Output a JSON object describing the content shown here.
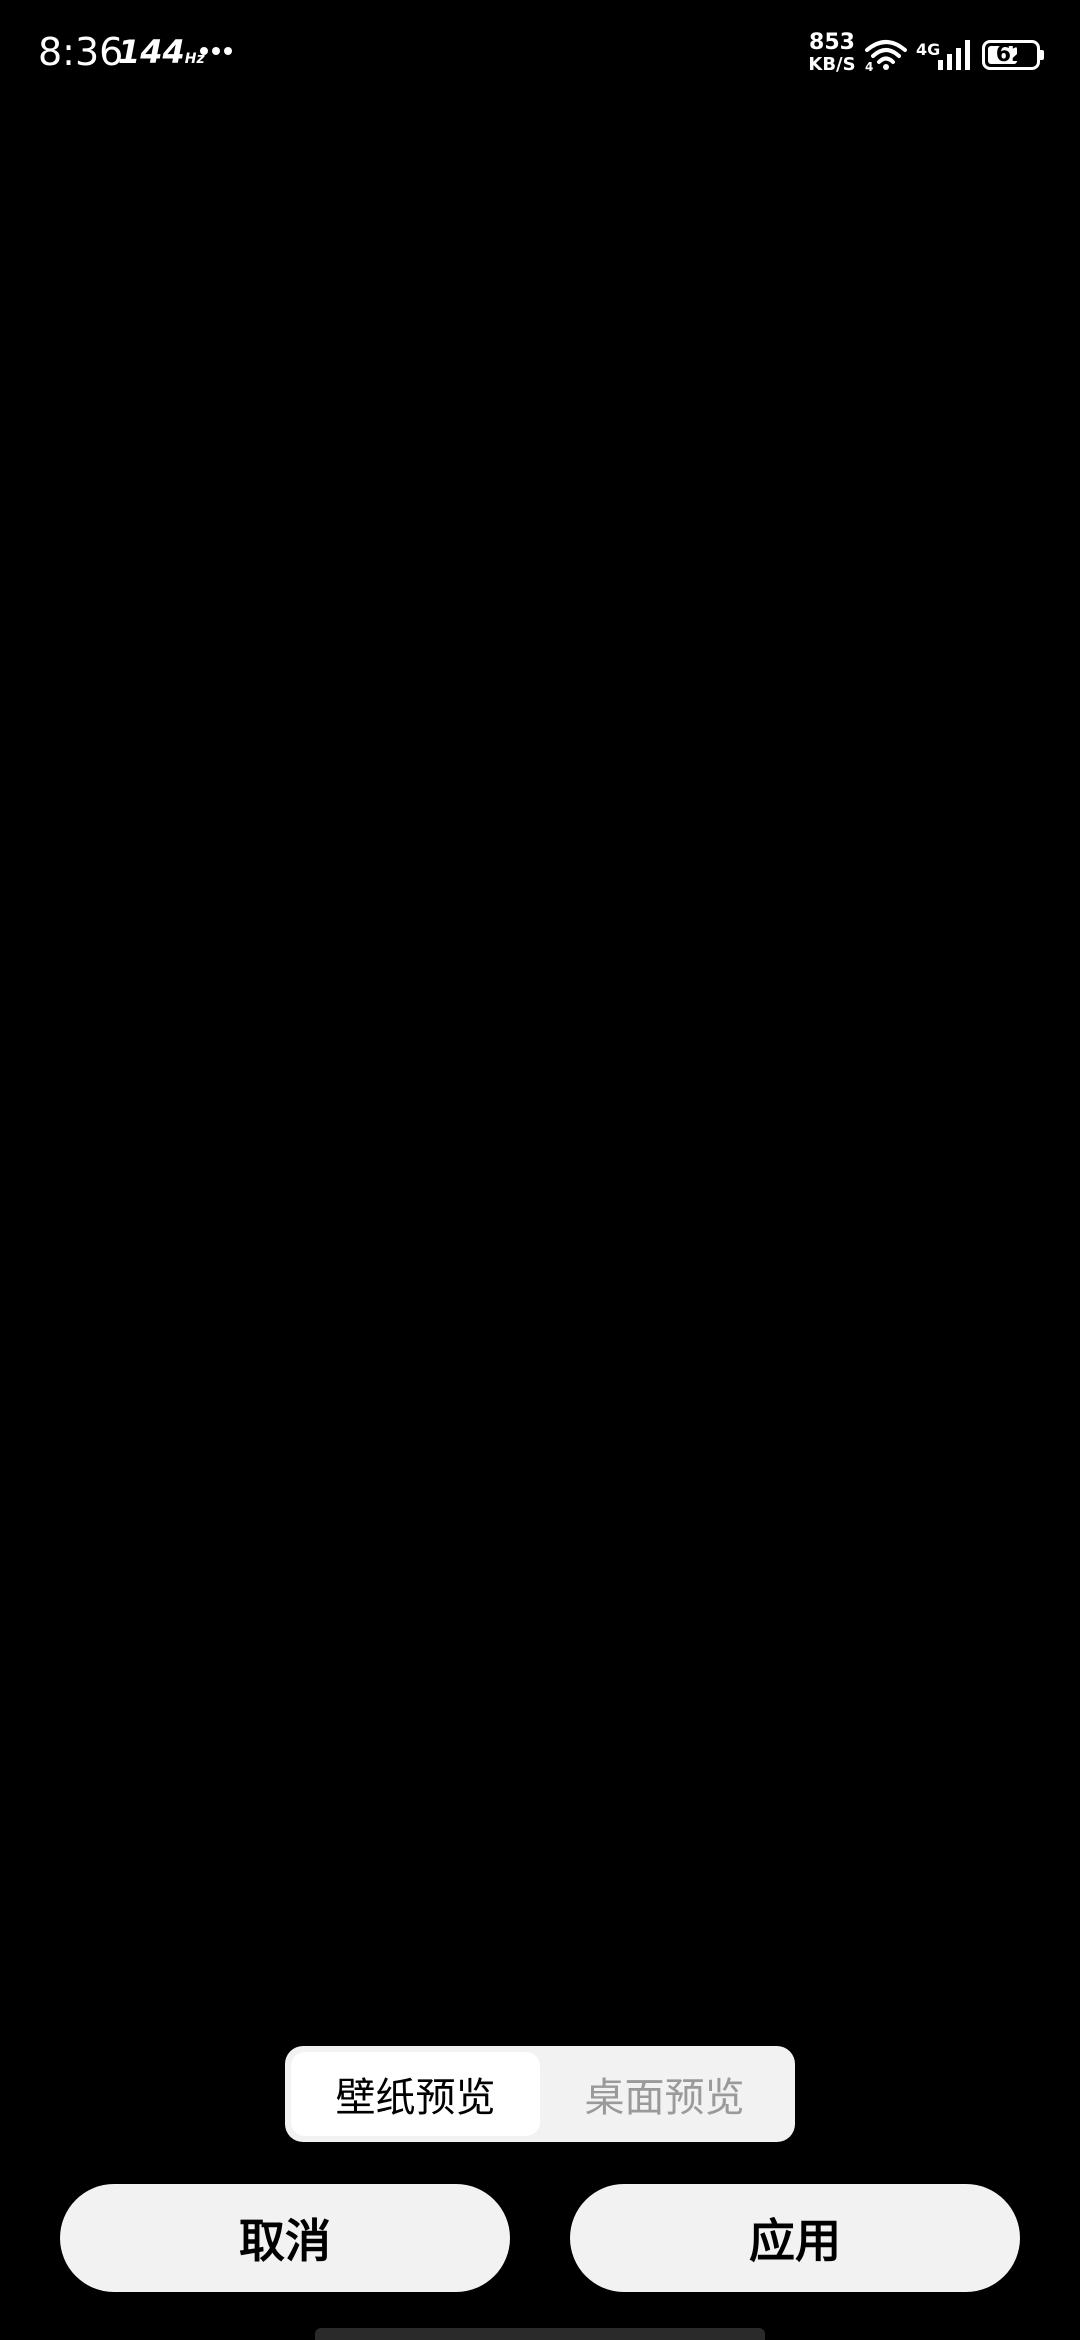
{
  "status_bar": {
    "time": "8:36",
    "refresh_rate": "144",
    "refresh_unit": "Hz",
    "net_speed_value": "853",
    "net_speed_unit": "KB/S",
    "wifi_sub": "4",
    "network_type": "4G",
    "battery_level": "62",
    "battery_fraction": 0.62
  },
  "segmented": {
    "active_label": "壁纸预览",
    "inactive_label": "桌面预览"
  },
  "actions": {
    "cancel_label": "取消",
    "apply_label": "应用"
  },
  "colors": {
    "background": "#000000",
    "control_bg": "#f2f2f2",
    "inactive_text": "#9a9a9a"
  }
}
